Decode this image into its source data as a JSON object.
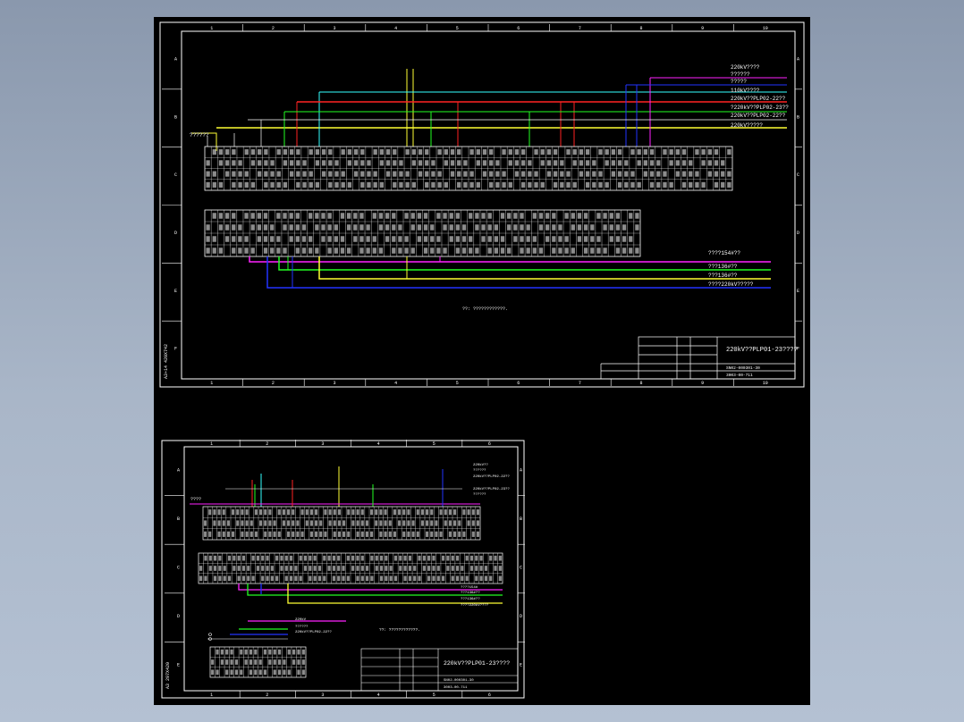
{
  "viewer": {
    "background_color": "#8fa0b6",
    "canvas_color": "#000000"
  },
  "colors": {
    "yellow": "#ffff33",
    "cyan": "#33ffff",
    "red": "#ff2222",
    "green": "#22ff22",
    "magenta": "#ff22ff",
    "blue": "#2233ff",
    "white": "#ffffff"
  },
  "sheet1": {
    "col_ticks": [
      "1",
      "2",
      "3",
      "4",
      "5",
      "6",
      "7",
      "8",
      "9",
      "10"
    ],
    "row_ticks": [
      "A",
      "B",
      "C",
      "D",
      "E",
      "F"
    ],
    "side_label": "A3+14 420X742",
    "left_label": "??????",
    "legend_lines": [
      "220kV????",
      "??????",
      "?????",
      "110kV????",
      "220kV??PLP02-22??",
      "?220kV??PLP02-23??",
      "220kV??PLP02-22??",
      "220kV?????"
    ],
    "bottom_lines": [
      "????154#??",
      "???136#??",
      "???136#??",
      "????220kV?????"
    ],
    "note": "??: ????????????.",
    "title_block": {
      "title": "220kV??PLP01-23????",
      "code1": "SN02-000301-30",
      "code2": "3003-00-711"
    }
  },
  "sheet2": {
    "col_ticks": [
      "1",
      "2",
      "3",
      "4",
      "5",
      "6"
    ],
    "row_ticks": [
      "A",
      "B",
      "C",
      "D",
      "E"
    ],
    "side_label": "A3 297X420",
    "left_label": "????",
    "legend_lines": [
      "220kV??",
      "??????",
      "220kV??PLP02-22??",
      "220kV??PLP02-23??",
      "??????"
    ],
    "bottom_lines": [
      "????154#",
      "???136#??",
      "???136#??",
      "????220kV????"
    ],
    "small_legend": [
      "220kV",
      "??????",
      "220kV??PLP02-22??"
    ],
    "note": "??: ????????????.",
    "title_block": {
      "title": "220kV??PLP01-23????",
      "code1": "SN02-000301-30",
      "code2": "3003-00-711"
    }
  }
}
